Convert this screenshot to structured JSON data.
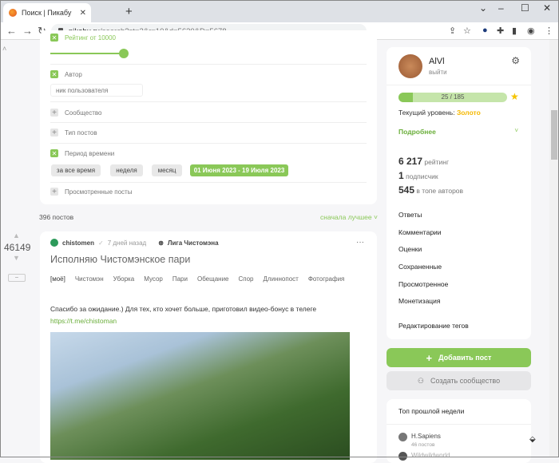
{
  "browser": {
    "tab_title": "Поиск | Пикабу",
    "url_domain": "pikabu.ru",
    "url_path": "/search?st=2&r=10&d=5630&D=5678"
  },
  "filters": {
    "rating_label": "Рейтинг от 10000",
    "author_label": "Автор",
    "author_placeholder": "ник пользователя",
    "community_label": "Сообщество",
    "post_type_label": "Тип постов",
    "period_label": "Период времени",
    "period_options": [
      "за все время",
      "неделя",
      "месяц",
      "01 Июня 2023 - 19 Июля 2023"
    ],
    "viewed_label": "Просмотренные посты"
  },
  "results": {
    "count": "396 постов",
    "sort": "сначала лучшее"
  },
  "post": {
    "rating": "46149",
    "author": "chistomen",
    "time": "7 дней назад",
    "community": "Лига Чистомэна",
    "title": "Исполняю Чистомэнское пари",
    "tags": [
      "[моё]",
      "Чистомэн",
      "Уборка",
      "Мусор",
      "Пари",
      "Обещание",
      "Спор",
      "Длиннопост",
      "Фотография"
    ],
    "text": "Спасибо за ожидание.) Для тех, кто хочет больше, приготовил видео-бонус в телеге",
    "link": "https://t.me/chistoman",
    "collapse": "–"
  },
  "profile": {
    "name": "AlVl",
    "logout": "выйти",
    "progress_text": "25 / 185",
    "progress_fraction": 0.135,
    "level_label": "Текущий уровень:",
    "level": "Золото",
    "more": "Подробнее",
    "rating_value": "6 217",
    "rating_label": "рейтинг",
    "subs_value": "1",
    "subs_label": "подписчик",
    "top_value": "545",
    "top_label": "в топе авторов",
    "menu": [
      "Ответы",
      "Комментарии",
      "Оценки",
      "Сохраненные",
      "Просмотренное",
      "Монетизация"
    ],
    "edit_tags": "Редактирование тегов"
  },
  "actions": {
    "add_post": "Добавить пост",
    "create_community": "Создать сообщество"
  },
  "top_week": {
    "title": "Топ прошлой недели",
    "users": [
      {
        "name": "H.Sapiens",
        "posts": "46 постов"
      },
      {
        "name": "Wildwildworld",
        "posts": ""
      }
    ]
  },
  "colors": {
    "accent": "#8ac858",
    "gold": "#f5b800"
  }
}
